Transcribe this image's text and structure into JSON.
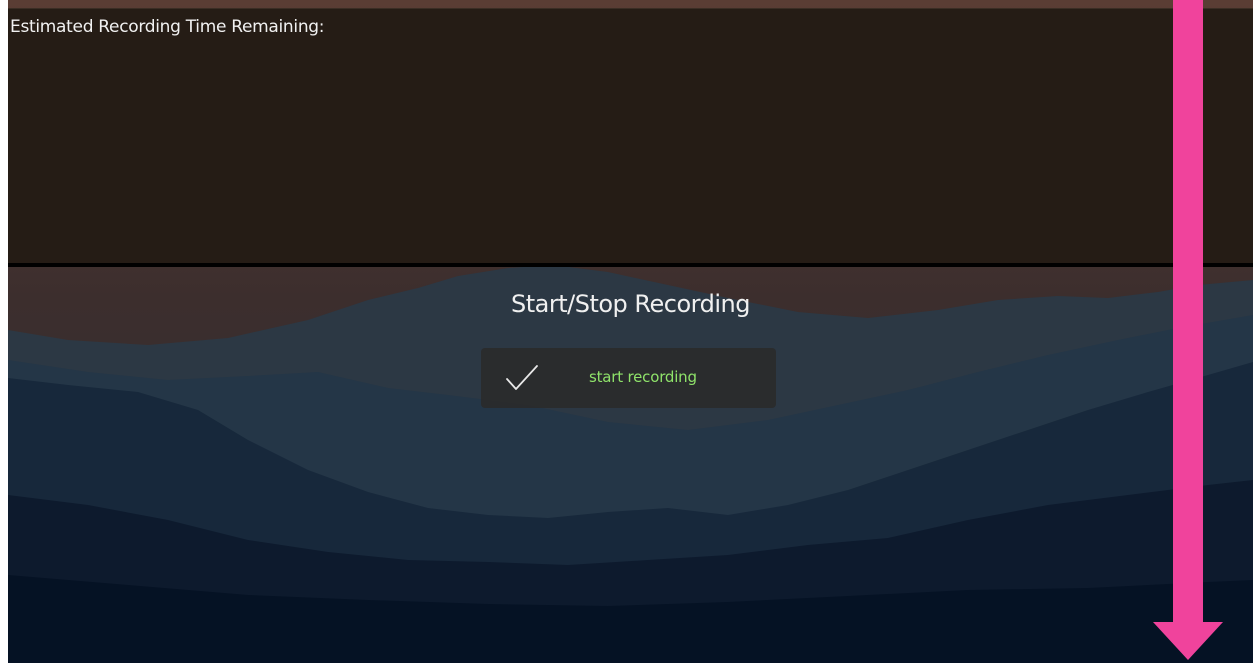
{
  "status_panel": {
    "label": "Estimated Recording Time Remaining:"
  },
  "recording": {
    "section_title": "Start/Stop Recording",
    "button_label": "start recording",
    "button_icon": "check-icon"
  },
  "overlay": {
    "icon": "down-arrow-icon",
    "color": "#f0439c"
  },
  "colors": {
    "panel_bg": "#251c15",
    "accent_green": "#8fe36a",
    "sky_top": "#5a3d34",
    "deep_blue": "#051224"
  }
}
